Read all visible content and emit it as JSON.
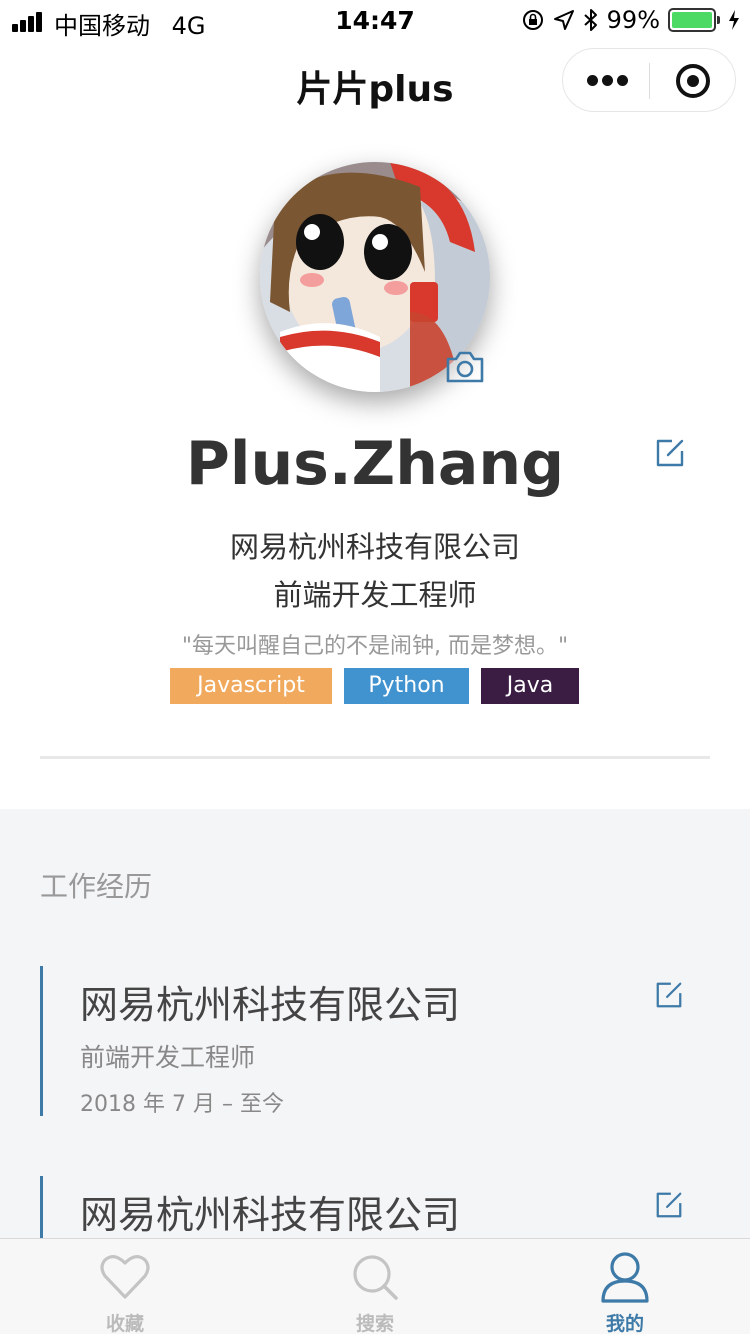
{
  "status_bar": {
    "carrier": "中国移动",
    "network": "4G",
    "time": "14:47",
    "battery_percent": "99%",
    "battery_level": 0.99
  },
  "nav": {
    "title": "片片plus"
  },
  "profile": {
    "name": "Plus.Zhang",
    "company": "网易杭州科技有限公司",
    "position": "前端开发工程师",
    "motto": "\"每天叫醒自己的不是闹钟, 而是梦想。\"",
    "tags": [
      {
        "label": "Javascript",
        "color": "#f0a95d"
      },
      {
        "label": "Python",
        "color": "#4193cf"
      },
      {
        "label": "Java",
        "color": "#3b1d44"
      }
    ]
  },
  "experience": {
    "title": "工作经历",
    "items": [
      {
        "company": "网易杭州科技有限公司",
        "position": "前端开发工程师",
        "date": "2018 年 7 月 – 至今"
      },
      {
        "company": "网易杭州科技有限公司",
        "position": "",
        "date": ""
      }
    ]
  },
  "tab_bar": {
    "items": [
      {
        "label": "收藏",
        "icon": "heart-icon",
        "active": false
      },
      {
        "label": "搜索",
        "icon": "search-icon",
        "active": false
      },
      {
        "label": "我的",
        "icon": "user-icon",
        "active": true
      }
    ]
  },
  "colors": {
    "accent": "#3e7aa8",
    "section_bg": "#f4f5f7"
  }
}
